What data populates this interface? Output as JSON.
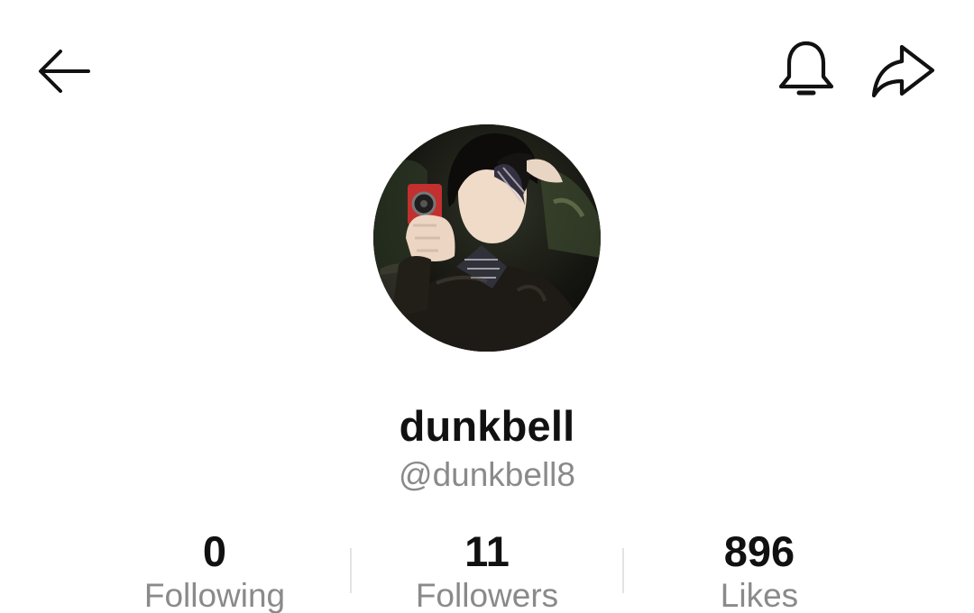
{
  "header": {
    "back_icon": "arrow-left-icon",
    "notification_icon": "bell-icon",
    "share_icon": "share-arrow-icon"
  },
  "profile": {
    "avatar": "profile-photo",
    "display_name": "dunkbell",
    "username": "@dunkbell8"
  },
  "stats": [
    {
      "value": "0",
      "label": "Following"
    },
    {
      "value": "11",
      "label": "Followers"
    },
    {
      "value": "896",
      "label": "Likes"
    }
  ]
}
